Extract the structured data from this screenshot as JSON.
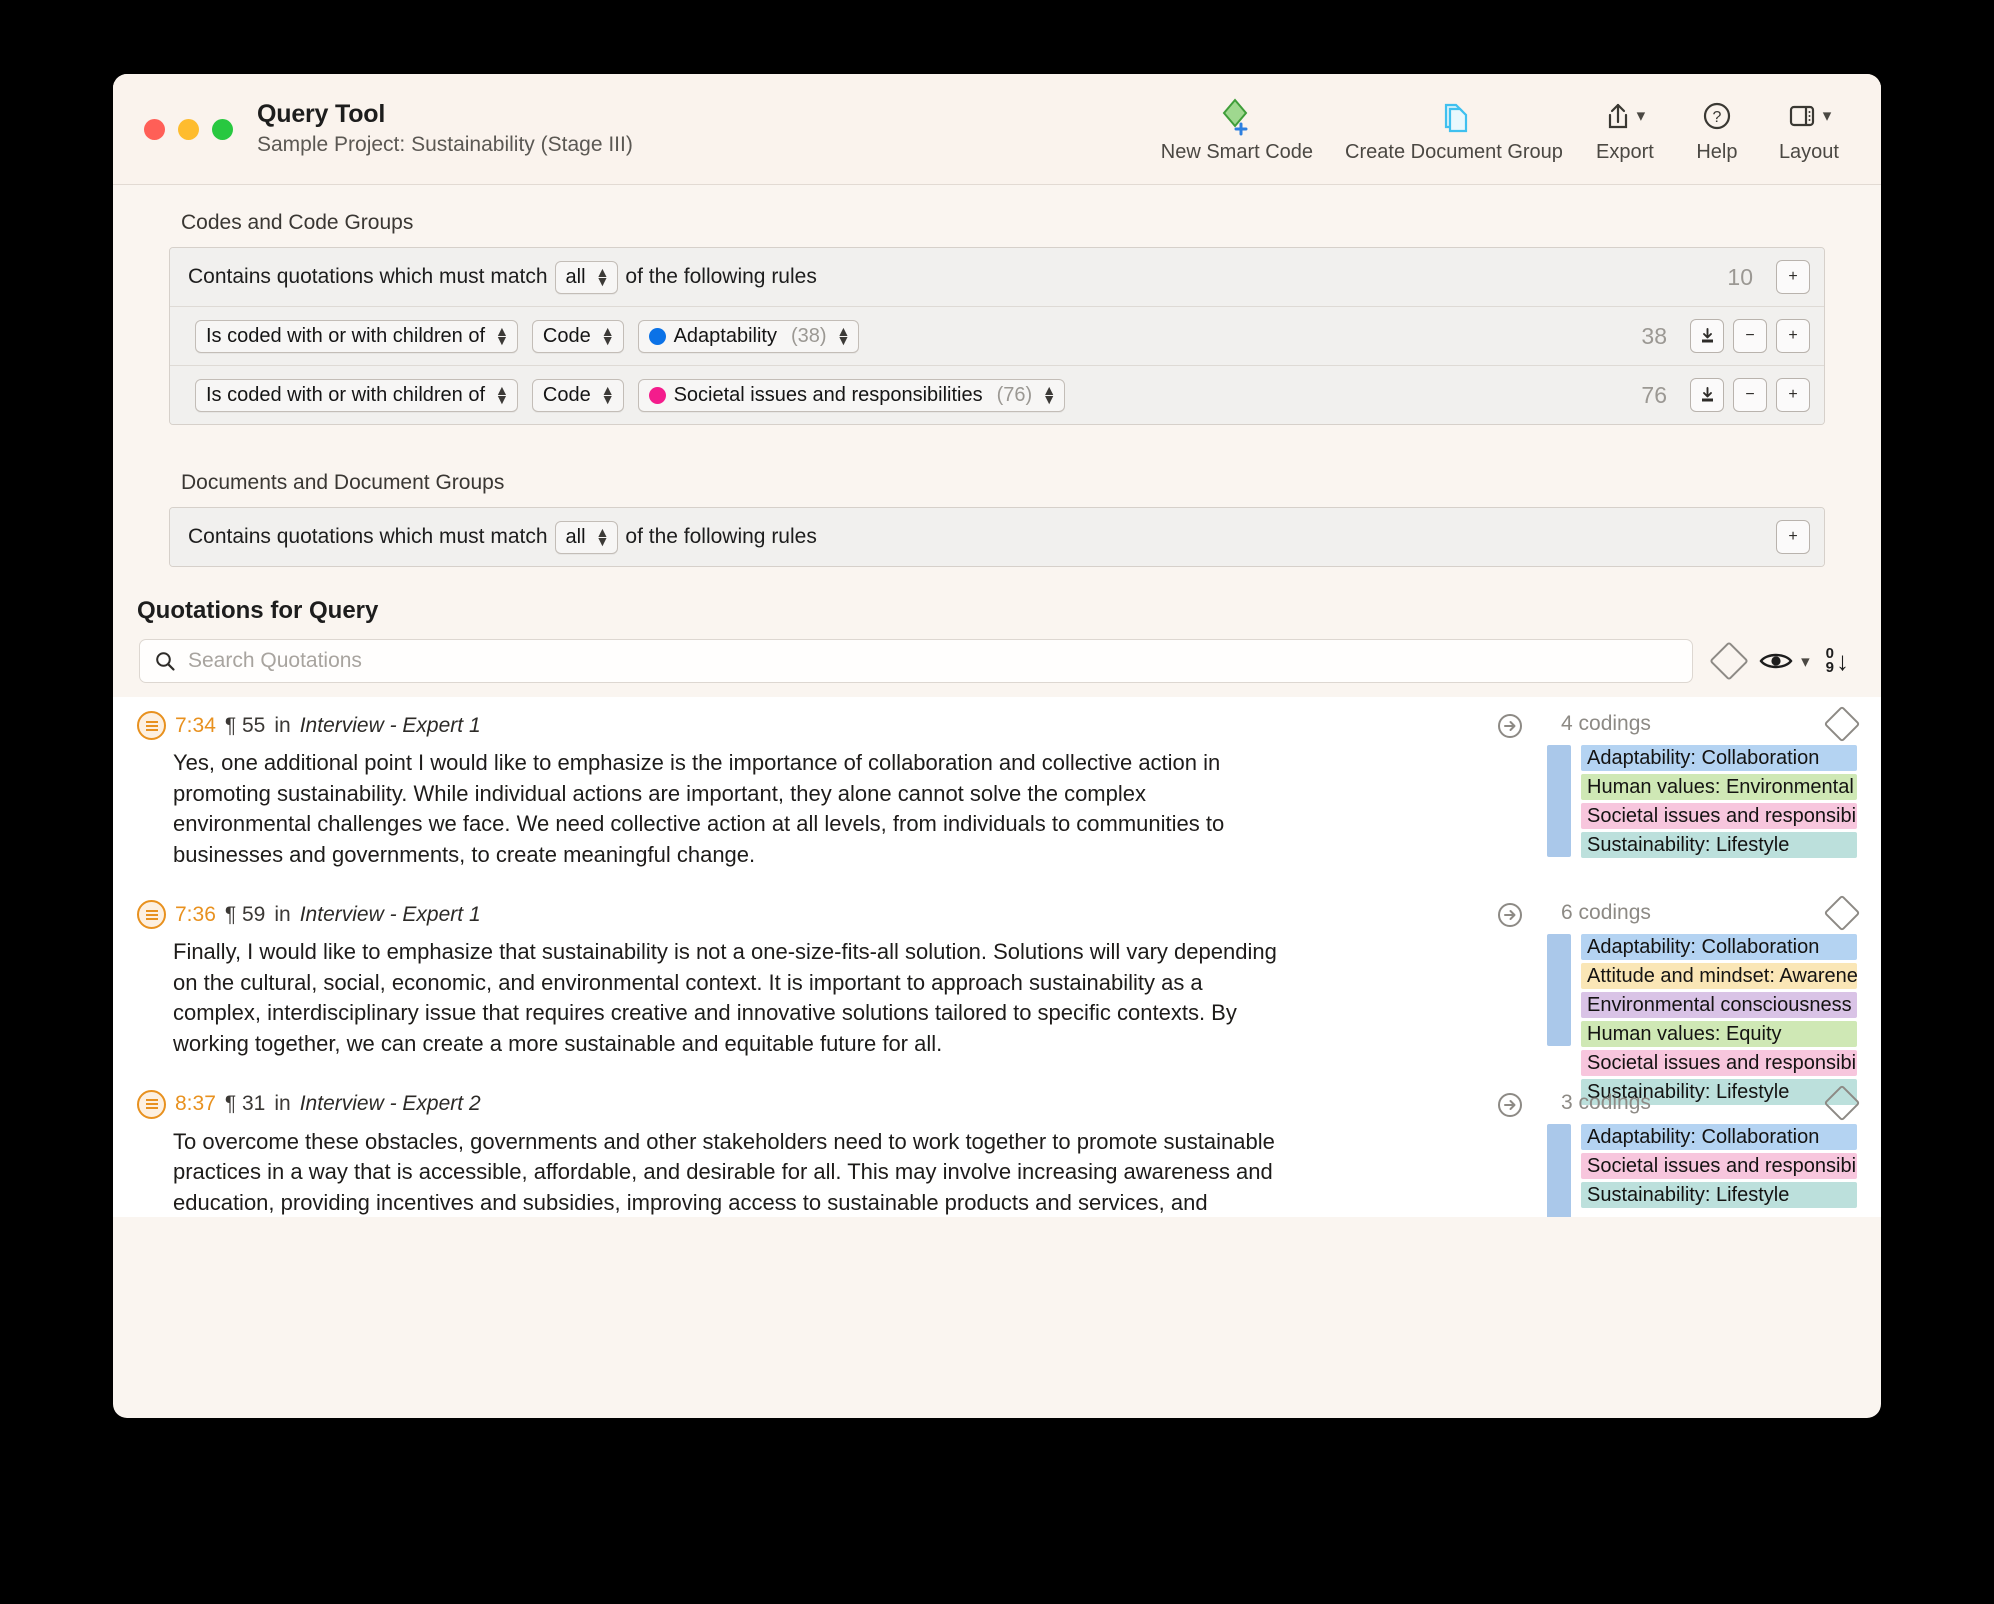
{
  "window": {
    "title": "Query Tool",
    "subtitle": "Sample Project: Sustainability (Stage III)"
  },
  "toolbar": {
    "items": [
      {
        "label": "New Smart Code",
        "icon": "smart-code-diamond-icon"
      },
      {
        "label": "Create Document Group",
        "icon": "document-group-icon"
      },
      {
        "label": "Export",
        "icon": "export-share-icon"
      },
      {
        "label": "Help",
        "icon": "help-question-icon"
      },
      {
        "label": "Layout",
        "icon": "layout-panel-icon"
      }
    ]
  },
  "codes_section": {
    "label": "Codes and Code Groups",
    "header_rule": {
      "prefix": "Contains quotations which must match",
      "match_value": "all",
      "suffix": "of the following rules",
      "count": "10",
      "add_label": "+"
    },
    "rules": [
      {
        "operator": "Is coded with or with children of",
        "entity": "Code",
        "target": "Adaptability",
        "target_count": "(38)",
        "color": "#0b72e7",
        "count": "38",
        "import_label": "⤓",
        "remove_label": "−",
        "add_label": "+"
      },
      {
        "operator": "Is coded with or with children of",
        "entity": "Code",
        "target": "Societal issues and responsibilities",
        "target_count": "(76)",
        "color": "#f41c8c",
        "count": "76",
        "import_label": "⤓",
        "remove_label": "−",
        "add_label": "+"
      }
    ]
  },
  "documents_section": {
    "label": "Documents and Document Groups",
    "header_rule": {
      "prefix": "Contains quotations which must match",
      "match_value": "all",
      "suffix": "of the following rules",
      "add_label": "+"
    }
  },
  "quotations": {
    "header": "Quotations for Query",
    "search": {
      "placeholder": "Search Quotations",
      "icon": "search-icon"
    },
    "toolbar_icons": {
      "filter": "diamond-filter-icon",
      "visibility": "eye-icon",
      "visibility_chevron": "chevron-down-icon",
      "sort_top": "0",
      "sort_bottom": "9",
      "sort_arrow": "↓"
    },
    "items": [
      {
        "id": "7:34",
        "paragraph": "¶ 55",
        "in_word": "in",
        "document": "Interview - Expert 1",
        "codings_count": "4 codings",
        "text": "Yes, one additional point I would like to emphasize is the importance of collaboration and collective action in promoting sustainability. While individual actions are important, they alone cannot solve the complex environmental challenges we face. We need collective action at all levels, from individuals to communities to businesses and governments, to create meaningful change.",
        "codings": [
          {
            "label": "Adaptability: Collaboration",
            "color": "#b4d3f2"
          },
          {
            "label": "Human values: Environmental",
            "color": "#cfe8b5"
          },
          {
            "label": "Societal issues and responsibilities",
            "color": "#f7c6dd"
          },
          {
            "label": "Sustainability: Lifestyle",
            "color": "#bce0dc"
          }
        ]
      },
      {
        "id": "7:36",
        "paragraph": "¶ 59",
        "in_word": "in",
        "document": "Interview - Expert 1",
        "codings_count": "6 codings",
        "text": "Finally, I would like to emphasize that sustainability is not a one-size-fits-all solution. Solutions will vary depending on the cultural, social, economic, and environmental context. It is important to approach sustainability as a complex, interdisciplinary issue that requires creative and innovative solutions tailored to specific contexts. By working together, we can create a more sustainable and equitable future for all.",
        "codings": [
          {
            "label": "Adaptability: Collaboration",
            "color": "#b4d3f2"
          },
          {
            "label": "Attitude and mindset: Awareness",
            "color": "#fae6b6"
          },
          {
            "label": "Environmental consciousness",
            "color": "#d9c3e6"
          },
          {
            "label": "Human values: Equity",
            "color": "#cfe8b5"
          },
          {
            "label": "Societal issues and responsibilities",
            "color": "#f7c6dd"
          },
          {
            "label": "Sustainability: Lifestyle",
            "color": "#bce0dc"
          }
        ]
      },
      {
        "id": "8:37",
        "paragraph": "¶ 31",
        "in_word": "in",
        "document": "Interview - Expert 2",
        "codings_count": "3 codings",
        "text": "To overcome these obstacles, governments and other stakeholders need to work together to promote sustainable practices in a way that is accessible, affordable, and desirable for all. This may involve increasing awareness and education, providing incentives and subsidies, improving access to sustainable products and services, and promoting social norms that support sustainable behaviors. It will require a comprehensive and integrated approach that involves individuals, communities, businesses, and governments working together t…",
        "codings": [
          {
            "label": "Adaptability: Collaboration",
            "color": "#b4d3f2"
          },
          {
            "label": "Societal issues and responsibilities",
            "color": "#f7c6dd"
          },
          {
            "label": "Sustainability: Lifestyle",
            "color": "#bce0dc"
          }
        ]
      }
    ]
  }
}
